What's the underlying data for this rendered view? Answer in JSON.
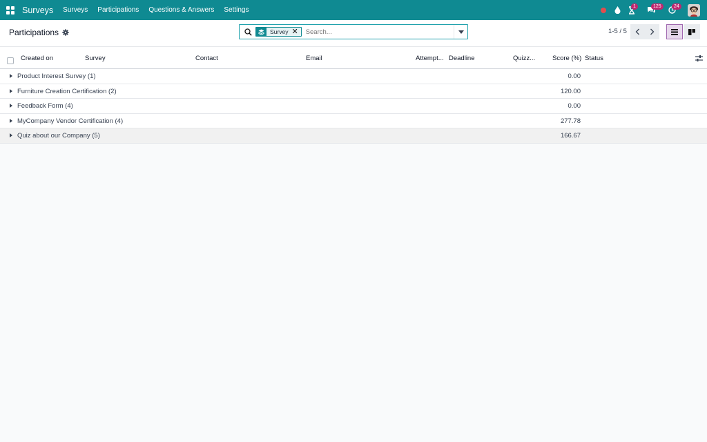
{
  "navbar": {
    "app_name": "Surveys",
    "menu": [
      "Surveys",
      "Participations",
      "Questions & Answers",
      "Settings"
    ],
    "activity_badge": "1",
    "messages_badge": "125",
    "updates_badge": "24"
  },
  "control_panel": {
    "title": "Participations",
    "search": {
      "facet_label": "Survey",
      "placeholder": "Search..."
    },
    "pager": "1-5 / 5"
  },
  "table": {
    "columns": [
      "Created on",
      "Survey",
      "Contact",
      "Email",
      "Attempt...",
      "Deadline",
      "Quizz...",
      "Score (%)",
      "Status"
    ],
    "groups": [
      {
        "name": "Product Interest Survey (1)",
        "score": "0.00"
      },
      {
        "name": "Furniture Creation Certification (2)",
        "score": "120.00"
      },
      {
        "name": "Feedback Form (4)",
        "score": "0.00"
      },
      {
        "name": "MyCompany Vendor Certification (4)",
        "score": "277.78"
      },
      {
        "name": "Quiz about our Company (5)",
        "score": "166.67"
      }
    ]
  },
  "colors": {
    "navbar": "#0f8a92",
    "accent": "#a16ab0",
    "badge": "#c0266f",
    "record_dot": "#e24d4d"
  }
}
